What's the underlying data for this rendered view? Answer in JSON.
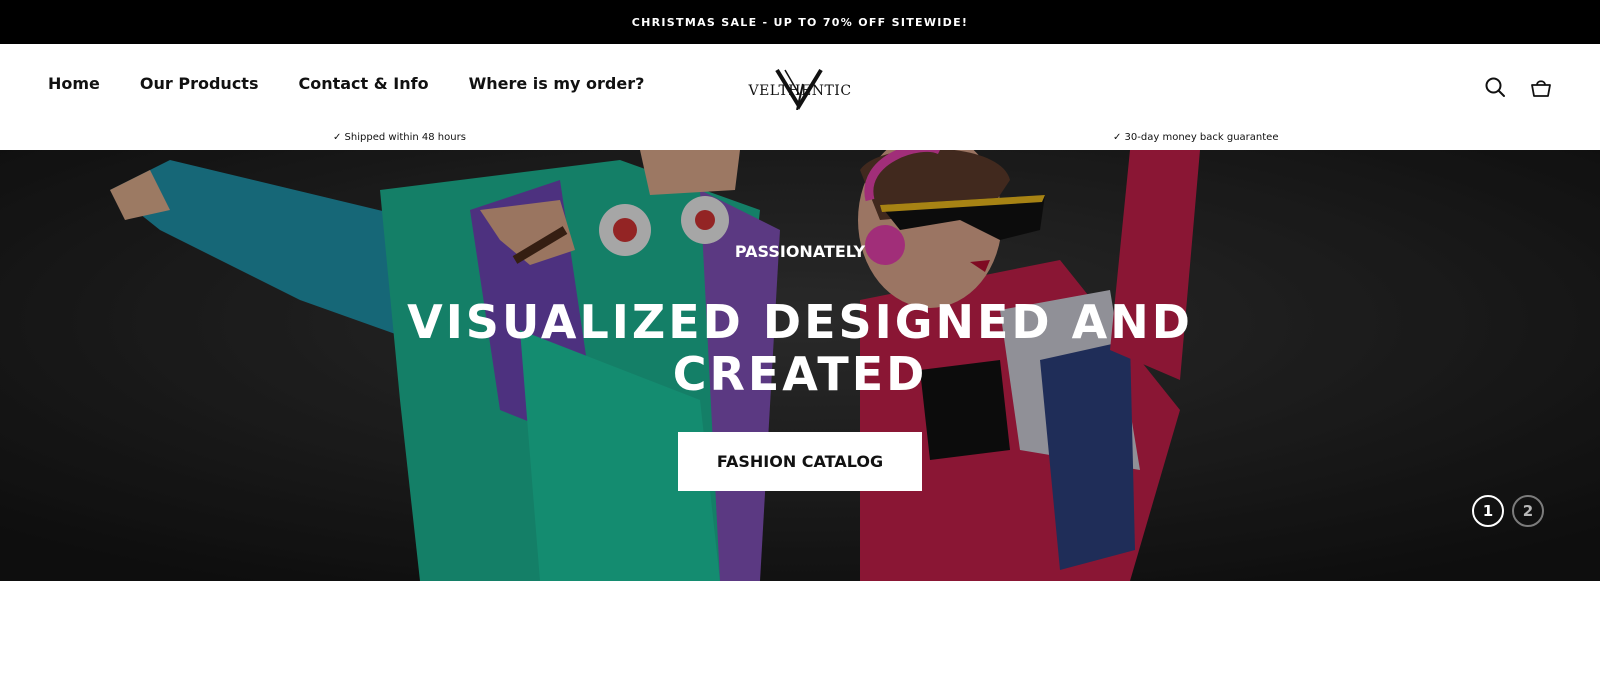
{
  "announcement": {
    "text": "CHRISTMAS SALE - UP TO 70% OFF SITEWIDE!"
  },
  "nav": {
    "items": [
      {
        "label": "Home"
      },
      {
        "label": "Our Products"
      },
      {
        "label": "Contact & Info"
      },
      {
        "label": "Where is my order?"
      }
    ]
  },
  "logo": {
    "text": "VELTHENTIC"
  },
  "header_icons": [
    "search-icon",
    "cart-icon"
  ],
  "usps": [
    {
      "text": "✓ Shipped within 48 hours"
    },
    {
      "text": "✓ 30-day money back guarantee"
    }
  ],
  "hero": {
    "kicker": "PASSIONATELY",
    "title": "VISUALIZED DESIGNED AND CREATED",
    "cta_label": "FASHION CATALOG",
    "pager": [
      {
        "label": "1",
        "active": true
      },
      {
        "label": "2",
        "active": false
      }
    ]
  },
  "colors": {
    "announcement_bg": "#000000",
    "text": "#111111",
    "hero_jacket_teal": "#1aa590",
    "hero_jacket_purple": "#6a4aa8",
    "hero_jacket_pink": "#c8244e"
  }
}
